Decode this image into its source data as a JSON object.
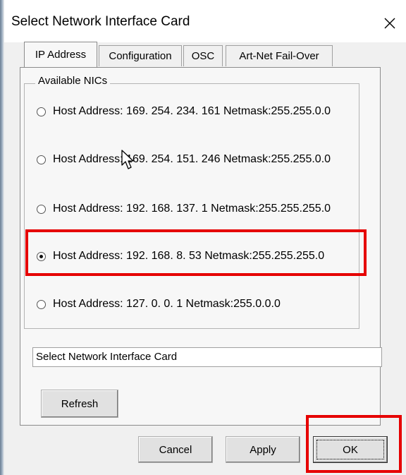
{
  "dialog": {
    "title": "Select Network Interface Card",
    "close_glyph": "✕"
  },
  "tabs": [
    {
      "label": "IP Address",
      "active": true
    },
    {
      "label": "Configuration",
      "active": false
    },
    {
      "label": "OSC",
      "active": false
    },
    {
      "label": "Art-Net Fail-Over",
      "active": false
    }
  ],
  "group": {
    "label": "Available NICs",
    "nics": [
      {
        "label": "Host Address:  169. 254. 234. 161 Netmask:255.255.0.0",
        "selected": false
      },
      {
        "label": "Host Address:  169. 254. 151. 246 Netmask:255.255.0.0",
        "selected": false
      },
      {
        "label": "Host Address:  192. 168. 137. 1 Netmask:255.255.255.0",
        "selected": false
      },
      {
        "label": "Host Address:  192. 168. 8. 53 Netmask:255.255.255.0",
        "selected": true
      },
      {
        "label": "Host Address:  127. 0. 0. 1 Netmask:255.0.0.0",
        "selected": false
      }
    ]
  },
  "status_field": {
    "value": "Select Network Interface Card"
  },
  "buttons": {
    "refresh": "Refresh",
    "cancel": "Cancel",
    "apply": "Apply",
    "ok": "OK"
  },
  "colors": {
    "highlight": "#e60000",
    "dialog_bg": "#f0f0f0"
  }
}
